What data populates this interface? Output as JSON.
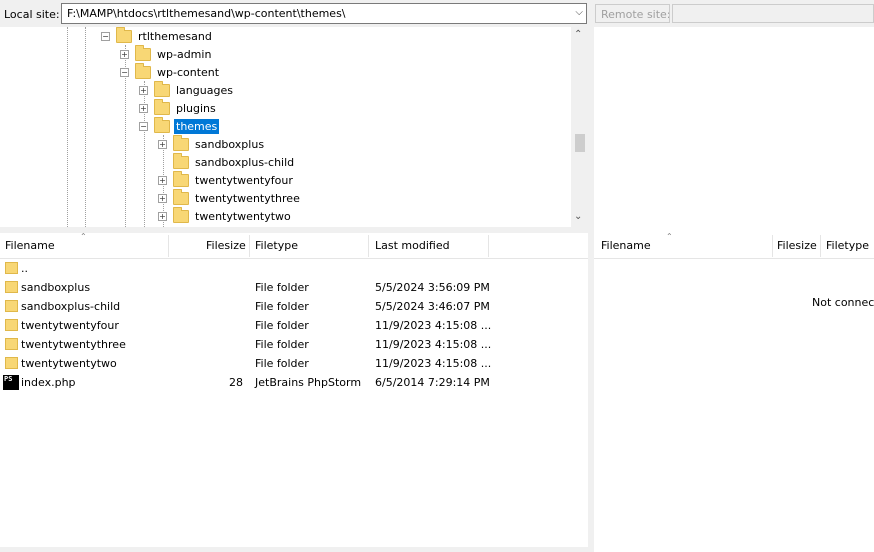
{
  "local": {
    "site_label": "Local site:",
    "path": "F:\\MAMP\\htdocs\\rtlthemesand\\wp-content\\themes\\",
    "tree": [
      {
        "label": "rtlthemesand",
        "expander": "−",
        "selected": false
      },
      {
        "label": "wp-admin",
        "expander": "+",
        "selected": false
      },
      {
        "label": "wp-content",
        "expander": "−",
        "selected": false
      },
      {
        "label": "languages",
        "expander": "+",
        "selected": false
      },
      {
        "label": "plugins",
        "expander": "+",
        "selected": false
      },
      {
        "label": "themes",
        "expander": "−",
        "selected": true
      },
      {
        "label": "sandboxplus",
        "expander": "+",
        "selected": false
      },
      {
        "label": "sandboxplus-child",
        "expander": "",
        "selected": false
      },
      {
        "label": "twentytwentyfour",
        "expander": "+",
        "selected": false
      },
      {
        "label": "twentytwentythree",
        "expander": "+",
        "selected": false
      },
      {
        "label": "twentytwentytwo",
        "expander": "+",
        "selected": false
      }
    ],
    "columns": {
      "filename": "Filename",
      "filesize": "Filesize",
      "filetype": "Filetype",
      "last_modified": "Last modified"
    },
    "files": [
      {
        "name": "..",
        "size": "",
        "type": "",
        "modified": "",
        "icon": "folder-icon"
      },
      {
        "name": "sandboxplus",
        "size": "",
        "type": "File folder",
        "modified": "5/5/2024 3:56:09 PM",
        "icon": "folder-icon"
      },
      {
        "name": "sandboxplus-child",
        "size": "",
        "type": "File folder",
        "modified": "5/5/2024 3:46:07 PM",
        "icon": "folder-icon"
      },
      {
        "name": "twentytwentyfour",
        "size": "",
        "type": "File folder",
        "modified": "11/9/2023 4:15:08 ...",
        "icon": "folder-icon"
      },
      {
        "name": "twentytwentythree",
        "size": "",
        "type": "File folder",
        "modified": "11/9/2023 4:15:08 ...",
        "icon": "folder-icon"
      },
      {
        "name": "twentytwentytwo",
        "size": "",
        "type": "File folder",
        "modified": "11/9/2023 4:15:08 ...",
        "icon": "folder-icon"
      },
      {
        "name": "index.php",
        "size": "28",
        "type": "JetBrains PhpStorm",
        "modified": "6/5/2014 7:29:14 PM",
        "icon": "phpstorm-icon"
      }
    ]
  },
  "remote": {
    "site_label": "Remote site:",
    "columns": {
      "filename": "Filename",
      "filesize": "Filesize",
      "filetype": "Filetype"
    },
    "status": "Not connec"
  },
  "icons": {
    "php_badge": "PS"
  },
  "colors": {
    "selection": "#0078d7",
    "folder": "#f8d775"
  }
}
